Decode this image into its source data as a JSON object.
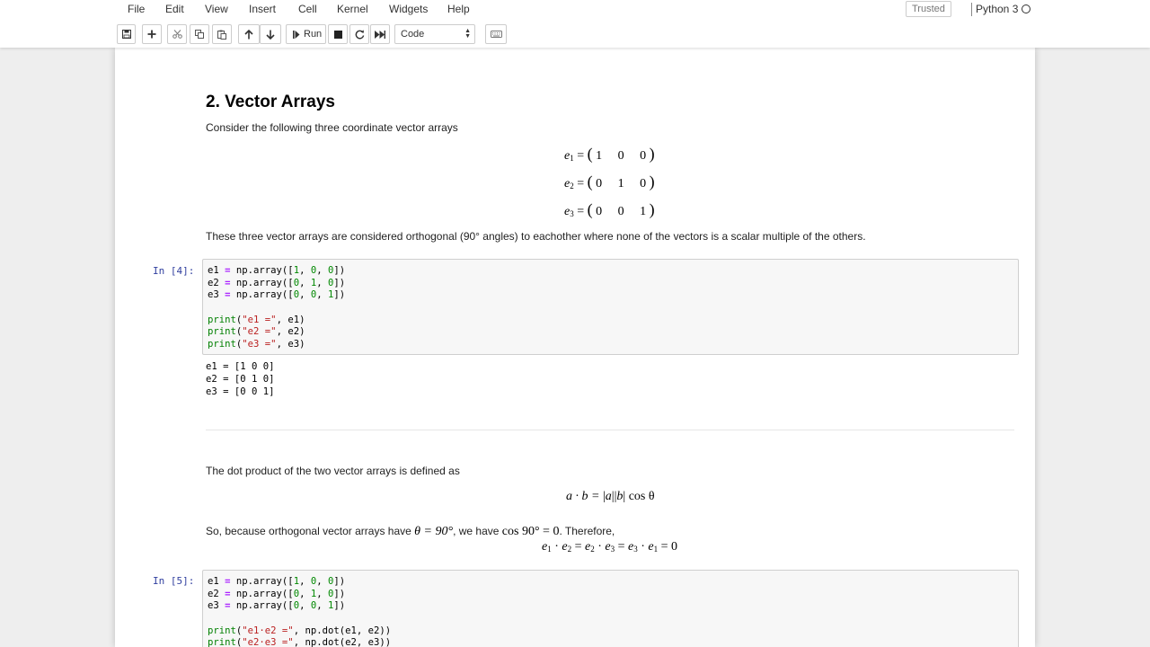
{
  "menubar": {
    "items": [
      "File",
      "Edit",
      "View",
      "Insert",
      "Cell",
      "Kernel",
      "Widgets",
      "Help"
    ],
    "trusted_label": "Trusted",
    "kernel_name": "Python 3"
  },
  "toolbar": {
    "run_label": "Run",
    "cell_type": "Code",
    "icons": [
      "save-icon",
      "plus-icon",
      "cut-icon",
      "copy-icon",
      "paste-icon",
      "arrow-up-icon",
      "arrow-down-icon",
      "run-icon",
      "stop-icon",
      "restart-icon",
      "fast-forward-icon",
      "keyboard-icon"
    ]
  },
  "notebook": {
    "section_title": "2. Vector Arrays",
    "intro_text": "Consider the following three coordinate vector arrays",
    "vectors": [
      {
        "name": "e",
        "sub": "1",
        "values": [
          "1",
          "0",
          "0"
        ]
      },
      {
        "name": "e",
        "sub": "2",
        "values": [
          "0",
          "1",
          "0"
        ]
      },
      {
        "name": "e",
        "sub": "3",
        "values": [
          "0",
          "0",
          "1"
        ]
      }
    ],
    "orthogonal_text": "These three vector arrays are considered orthogonal (90° angles) to eachother where none of the vectors is a scalar multiple of the others.",
    "cell4": {
      "prompt": "In [4]:",
      "outputs": [
        "e1 = [1 0 0]",
        "e2 = [0 1 0]",
        "e3 = [0 0 1]"
      ]
    },
    "dot_text": "The dot product of the two vector arrays is defined as",
    "dot_formula": {
      "lhs": "a · b = ",
      "rhs": "cos θ"
    },
    "so_text": {
      "part1": "So, because orthogonal vector arrays have ",
      "theta_eq": "θ = 90°",
      "part2": ", we have ",
      "cos_eq": "cos 90° = 0",
      "part3": ". Therefore,"
    },
    "cell5": {
      "prompt": "In [5]:"
    }
  }
}
